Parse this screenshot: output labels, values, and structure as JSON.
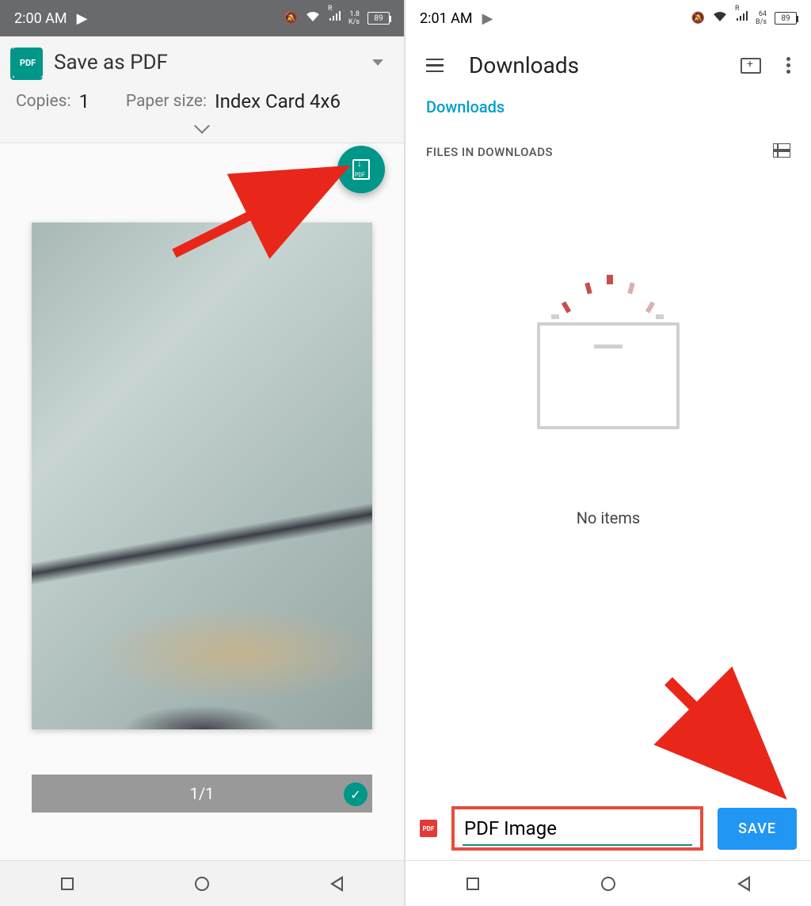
{
  "left": {
    "statusbar": {
      "time": "2:00 AM",
      "data_rate": "1.8",
      "data_unit": "K/s",
      "battery": "89"
    },
    "print": {
      "target": "Save as PDF",
      "copies_label": "Copies:",
      "copies_value": "1",
      "paper_label": "Paper size:",
      "paper_value": "Index Card 4x6",
      "page_counter": "1/1"
    },
    "icons": {
      "pdf_badge": "PDF",
      "network_flag": "R"
    }
  },
  "right": {
    "statusbar": {
      "time": "2:01 AM",
      "data_rate": "64",
      "data_unit": "B/s",
      "battery": "89"
    },
    "appbar": {
      "title": "Downloads"
    },
    "breadcrumb": "Downloads",
    "section_label": "FILES IN DOWNLOADS",
    "empty_text": "No items",
    "filename_value": "PDF Image",
    "save_label": "SAVE",
    "icons": {
      "pdf_mini": "PDF",
      "network_flag": "R"
    }
  }
}
